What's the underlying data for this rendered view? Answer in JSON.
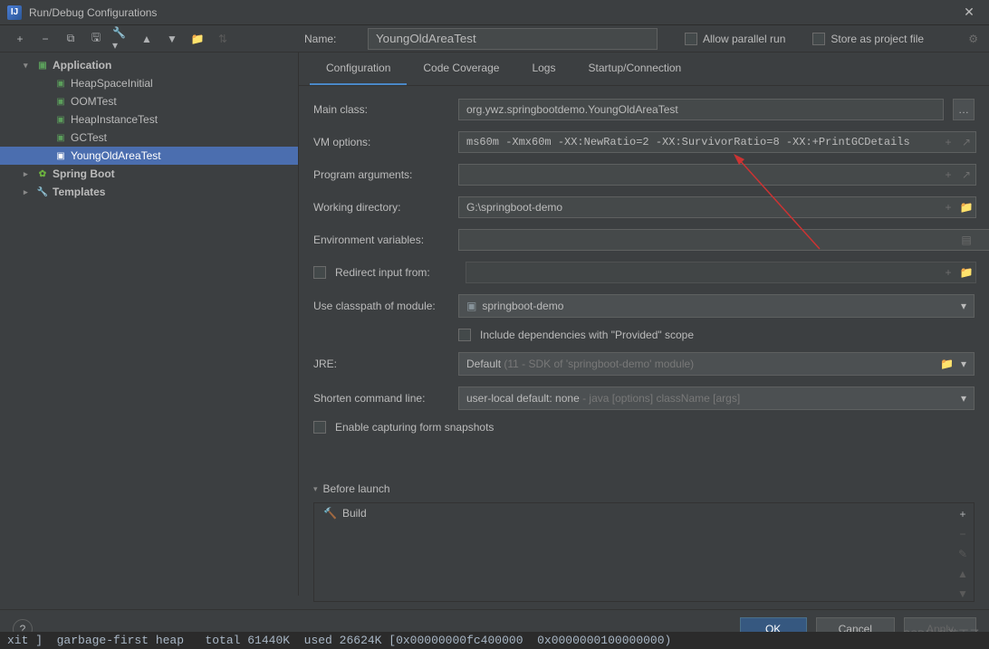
{
  "title": "Run/Debug Configurations",
  "header": {
    "name_label": "Name:",
    "name_value": "YoungOldAreaTest",
    "allow_parallel": "Allow parallel run",
    "store_as_project": "Store as project file"
  },
  "sidebar": {
    "application_label": "Application",
    "items": [
      "HeapSpaceInitial",
      "OOMTest",
      "HeapInstanceTest",
      "GCTest",
      "YoungOldAreaTest"
    ],
    "spring_boot": "Spring Boot",
    "templates": "Templates"
  },
  "tabs": {
    "configuration": "Configuration",
    "coverage": "Code Coverage",
    "logs": "Logs",
    "startup": "Startup/Connection"
  },
  "form": {
    "main_class_label": "Main class:",
    "main_class_value": "org.ywz.springbootdemo.YoungOldAreaTest",
    "vm_options_label": "VM options:",
    "vm_options_value": "ms60m -Xmx60m -XX:NewRatio=2 -XX:SurvivorRatio=8 -XX:+PrintGCDetails",
    "program_args_label": "Program arguments:",
    "program_args_value": "",
    "working_dir_label": "Working directory:",
    "working_dir_value": "G:\\springboot-demo",
    "env_vars_label": "Environment variables:",
    "env_vars_value": "",
    "redirect_input_label": "Redirect input from:",
    "redirect_input_value": "",
    "classpath_label": "Use classpath of module:",
    "classpath_value": "springboot-demo",
    "include_deps_label": "Include dependencies with \"Provided\" scope",
    "jre_label": "JRE:",
    "jre_value": "Default",
    "jre_hint": "(11 - SDK of 'springboot-demo' module)",
    "shorten_label": "Shorten command line:",
    "shorten_value": "user-local default: none",
    "shorten_hint": "- java [options] className [args]",
    "enable_snapshots_label": "Enable capturing form snapshots"
  },
  "before_launch": {
    "title": "Before launch",
    "build": "Build"
  },
  "footer": {
    "ok": "OK",
    "cancel": "Cancel",
    "apply": "Apply"
  },
  "watermark": "CSDN @游王子",
  "bottom_code": "xit ]  garbage-first heap   total 61440K  used 26624K [0x00000000fc400000  0x0000000100000000)"
}
